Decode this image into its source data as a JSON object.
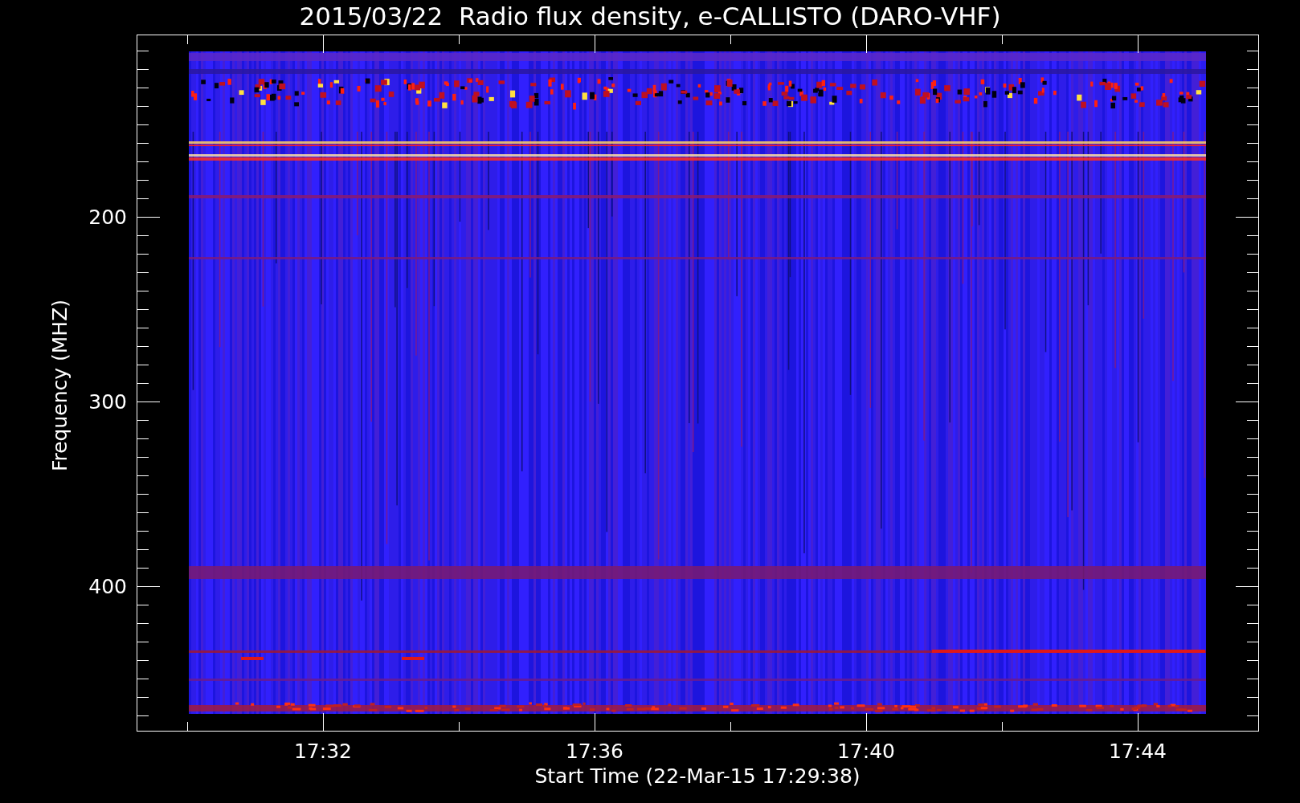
{
  "title": "2015/03/22  Radio flux density, e-CALLISTO (DARO-VHF)",
  "y_axis": {
    "label": "Frequency (MHZ)",
    "ticks": [
      "200",
      "300",
      "400"
    ]
  },
  "x_axis": {
    "label": "Start Time (22-Mar-15 17:29:38)",
    "ticks": [
      "17:32",
      "17:36",
      "17:40",
      "17:44"
    ]
  }
}
